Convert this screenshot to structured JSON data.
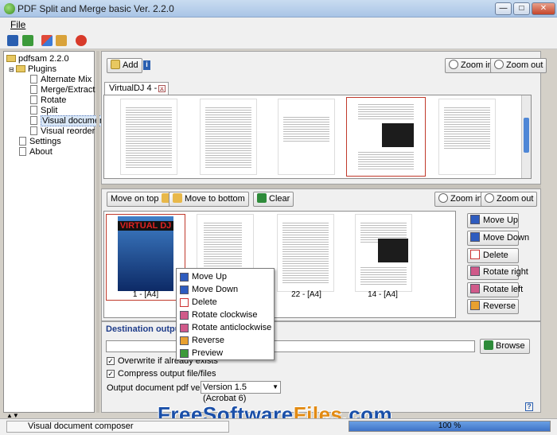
{
  "window": {
    "title": "PDF Split and Merge basic Ver. 2.2.0",
    "minimize": "—",
    "maximize": "□",
    "close": "✕"
  },
  "menu": {
    "file": "File"
  },
  "tree": {
    "root": "pdfsam 2.2.0",
    "plugins": "Plugins",
    "items": [
      "Alternate Mix",
      "Merge/Extract",
      "Rotate",
      "Split",
      "Visual document",
      "Visual reorder"
    ],
    "settings": "Settings",
    "about": "About",
    "selected": "Visual document"
  },
  "top_panel": {
    "add": "Add",
    "zoom_in": "Zoom in",
    "zoom_out": "Zoom out",
    "tab_label": "VirtualDJ 4 - ..",
    "tab_close": "x"
  },
  "mid_panel": {
    "move_on_top": "Move on top",
    "move_to_bottom": "Move to bottom",
    "clear": "Clear",
    "zoom_in": "Zoom in",
    "zoom_out": "Zoom out",
    "thumb_cover_text": "VIRTUAL DJ",
    "page_labels": [
      "1 - [A4]",
      "22 - [A4]",
      "14 - [A4]"
    ]
  },
  "side_buttons": [
    "Move Up",
    "Move Down",
    "Delete",
    "Rotate right",
    "Rotate left",
    "Reverse"
  ],
  "context_menu": [
    "Move Up",
    "Move Down",
    "Delete",
    "Rotate clockwise",
    "Rotate anticlockwise",
    "Reverse",
    "Preview"
  ],
  "bottom_panel": {
    "destination_label": "Destination output file",
    "browse": "Browse",
    "overwrite": "Overwrite if already exists",
    "compress": "Compress output file/files",
    "version_label": "Output document pdf version:",
    "version_value": "Version 1.5 (Acrobat 6)",
    "help": "?"
  },
  "status": {
    "text": "Visual document composer",
    "progress": 100,
    "progress_label": "100 %"
  },
  "watermark": {
    "part1": "FreeSoftware",
    "part2": "Files",
    "part3": ".com"
  },
  "colors": {
    "accent": "#1e3c8a",
    "progress": "#3e73c7",
    "watermark_blue": "#1a4fa8",
    "watermark_orange": "#e28a12"
  }
}
